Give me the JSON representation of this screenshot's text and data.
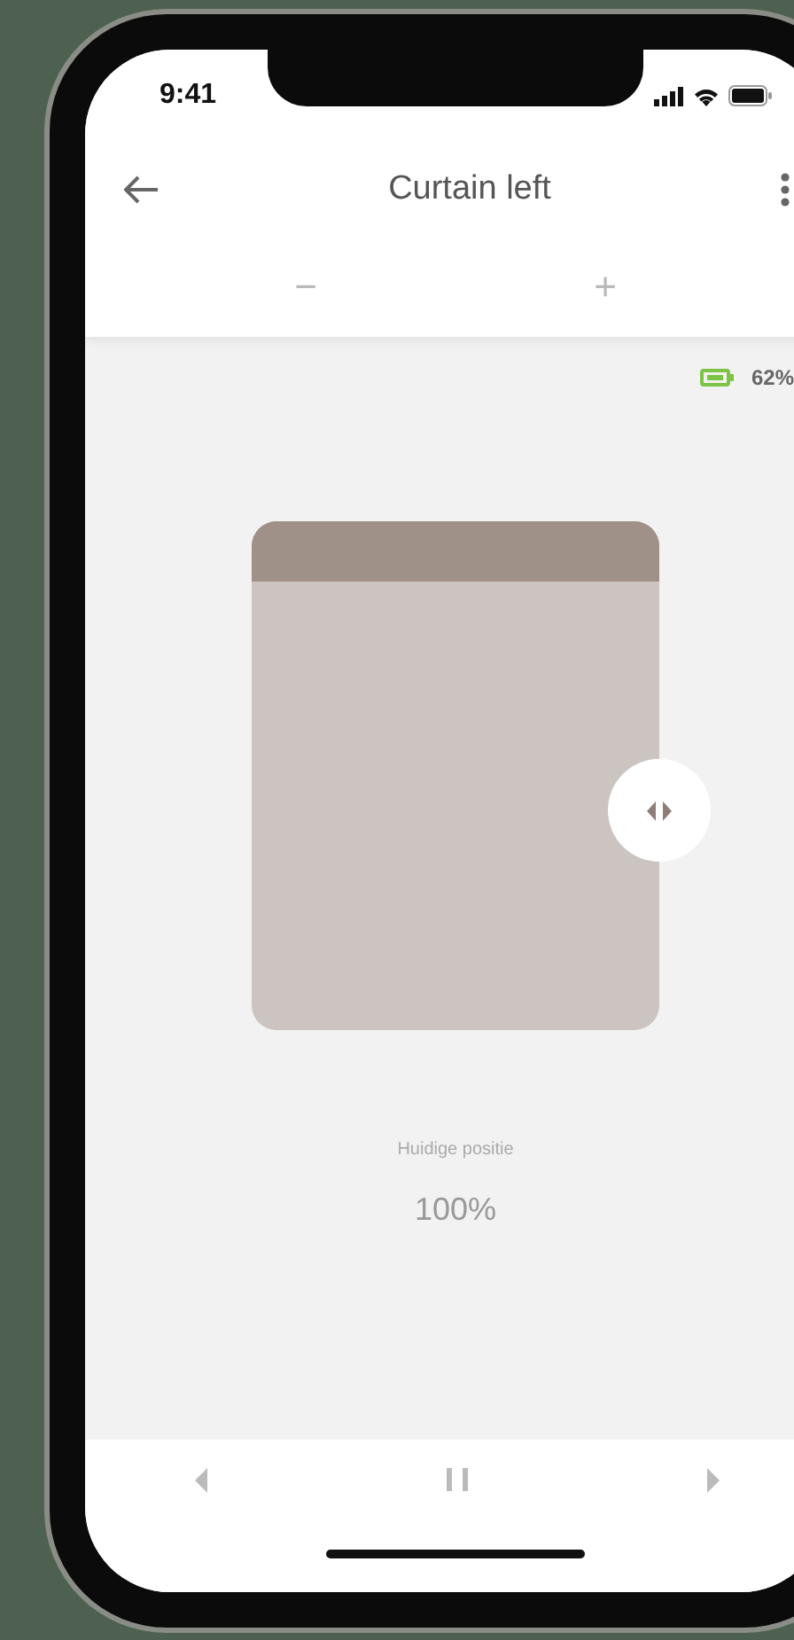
{
  "status_bar": {
    "time": "9:41"
  },
  "header": {
    "title": "Curtain left",
    "step_buttons": [
      "−",
      "+"
    ]
  },
  "battery": {
    "reading": "62%"
  },
  "curtain": {
    "level": 1
  },
  "position": {
    "label": "Huidige positie",
    "reading": "100%"
  },
  "controls": [
    {
      "kind": "left"
    },
    {
      "kind": "pause"
    },
    {
      "kind": "right"
    }
  ]
}
